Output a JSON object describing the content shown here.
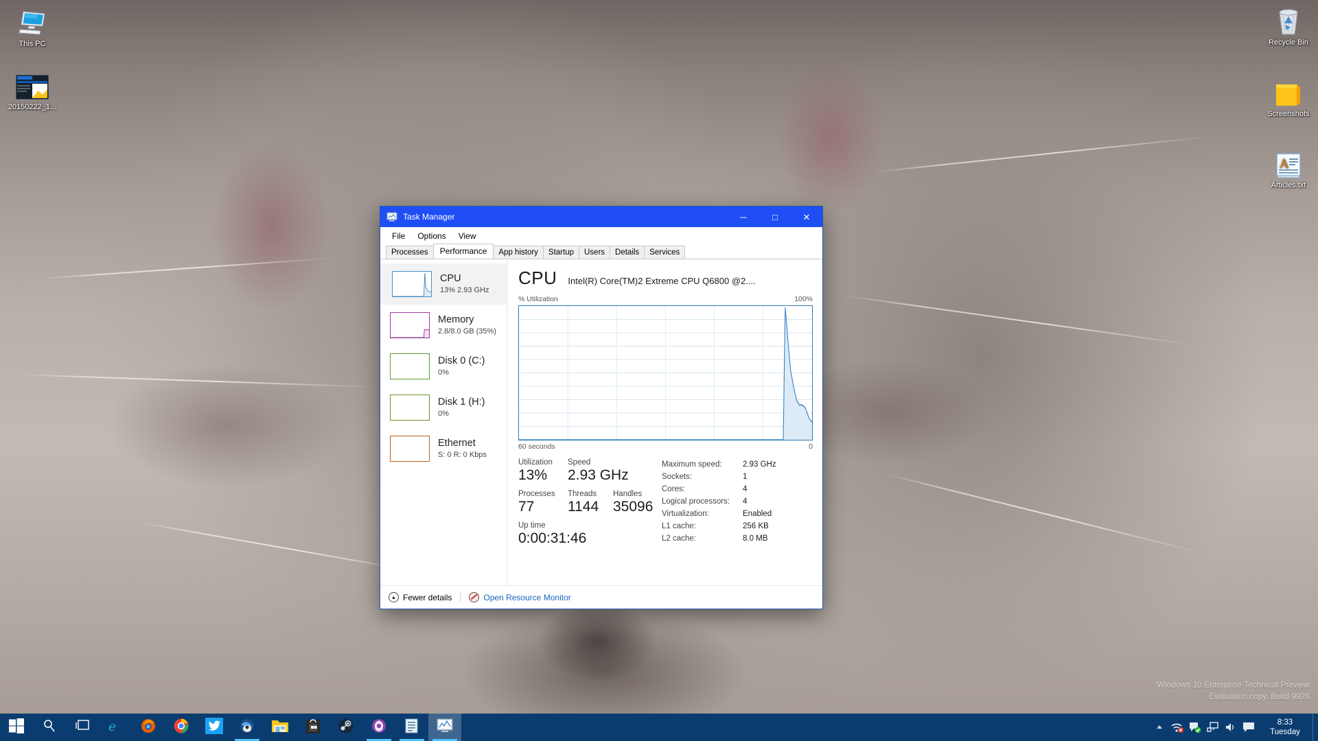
{
  "desktop": {
    "icons_left": [
      {
        "label": "This PC",
        "icon": "this-pc-icon"
      },
      {
        "label": "20150222_1...",
        "icon": "image-thumbnail-icon"
      }
    ],
    "icons_right": [
      {
        "label": "Recycle Bin",
        "icon": "recycle-bin-icon"
      },
      {
        "label": "Screenshots",
        "icon": "folder-icon"
      },
      {
        "label": "Articles.txt",
        "icon": "text-document-icon"
      }
    ],
    "watermark_line1": "Windows 10 Enterprise Technical Preview",
    "watermark_line2": "Evaluation copy. Build 9926"
  },
  "window": {
    "title": "Task Manager",
    "title_icon": "task-manager-icon",
    "minimize_glyph": "─",
    "maximize_glyph": "□",
    "close_glyph": "✕",
    "menu": [
      "File",
      "Options",
      "View"
    ],
    "tabs": [
      {
        "label": "Processes",
        "active": false
      },
      {
        "label": "Performance",
        "active": true
      },
      {
        "label": "App history",
        "active": false
      },
      {
        "label": "Startup",
        "active": false
      },
      {
        "label": "Users",
        "active": false
      },
      {
        "label": "Details",
        "active": false
      },
      {
        "label": "Services",
        "active": false
      }
    ],
    "footer": {
      "fewer_details": "Fewer details",
      "fewer_details_glyph": "▲",
      "open_resource_monitor": "Open Resource Monitor"
    }
  },
  "resources": [
    {
      "name": "CPU",
      "sub": "13% 2.93 GHz",
      "color": "#4b8dc4",
      "selected": true
    },
    {
      "name": "Memory",
      "sub": "2.8/8.0 GB (35%)",
      "color": "#9c3ba0",
      "selected": false
    },
    {
      "name": "Disk 0 (C:)",
      "sub": "0%",
      "color": "#5b9a2e",
      "selected": false
    },
    {
      "name": "Disk 1 (H:)",
      "sub": "0%",
      "color": "#6b8f2e",
      "selected": false
    },
    {
      "name": "Ethernet",
      "sub": "S: 0 R: 0 Kbps",
      "color": "#b5651d",
      "selected": false
    }
  ],
  "cpu": {
    "heading": "CPU",
    "model": "Intel(R) Core(TM)2 Extreme CPU Q6800 @2....",
    "graph_top_left": "% Utilization",
    "graph_top_right": "100%",
    "graph_bottom_left": "60 seconds",
    "graph_bottom_right": "0",
    "stats": {
      "utilization_label": "Utilization",
      "utilization_value": "13%",
      "speed_label": "Speed",
      "speed_value": "2.93 GHz",
      "processes_label": "Processes",
      "processes_value": "77",
      "threads_label": "Threads",
      "threads_value": "1144",
      "handles_label": "Handles",
      "handles_value": "35096",
      "uptime_label": "Up time",
      "uptime_value": "0:00:31:46"
    },
    "info": [
      {
        "key": "Maximum speed:",
        "value": "2.93 GHz"
      },
      {
        "key": "Sockets:",
        "value": "1"
      },
      {
        "key": "Cores:",
        "value": "4"
      },
      {
        "key": "Logical processors:",
        "value": "4"
      },
      {
        "key": "Virtualization:",
        "value": "Enabled"
      },
      {
        "key": "L1 cache:",
        "value": "256 KB"
      },
      {
        "key": "L2 cache:",
        "value": "8.0 MB"
      }
    ]
  },
  "chart_data": {
    "type": "area",
    "title": "CPU % Utilization",
    "xlabel": "60 seconds",
    "ylabel": "% Utilization",
    "ylim": [
      0,
      100
    ],
    "xlim": [
      60,
      0
    ],
    "grid": true,
    "grid_cols": 6,
    "grid_rows": 10,
    "line_color": "#3f87c7",
    "fill_color": "#dcebf7",
    "note": "Idle for most of the 60s window; a spike to 100% occurred ~4s ago then decayed to ~13%.",
    "x": [
      60,
      55,
      50,
      45,
      40,
      35,
      30,
      25,
      20,
      15,
      10,
      8,
      7,
      6,
      5,
      4.5,
      4,
      3.5,
      3,
      2.5,
      2,
      1.5,
      1,
      0.5,
      0
    ],
    "values": [
      0,
      0,
      0,
      0,
      0,
      0,
      0,
      0,
      0,
      0,
      0,
      0,
      0,
      0,
      0,
      0,
      100,
      72,
      52,
      40,
      30,
      22,
      15,
      14,
      13
    ]
  },
  "taskbar": {
    "items": [
      {
        "name": "start-button",
        "icon": "windows-logo-icon",
        "running": false,
        "active": false
      },
      {
        "name": "search-button",
        "icon": "search-icon",
        "running": false,
        "active": false
      },
      {
        "name": "task-view-button",
        "icon": "task-view-icon",
        "running": false,
        "active": false
      },
      {
        "name": "internet-explorer",
        "icon": "internet-explorer-icon",
        "running": false,
        "active": false
      },
      {
        "name": "firefox",
        "icon": "firefox-icon",
        "running": false,
        "active": false
      },
      {
        "name": "chrome",
        "icon": "chrome-icon",
        "running": false,
        "active": false
      },
      {
        "name": "twitter",
        "icon": "twitter-icon",
        "running": false,
        "active": false
      },
      {
        "name": "thunderbird",
        "icon": "thunderbird-icon",
        "running": true,
        "active": false
      },
      {
        "name": "file-explorer",
        "icon": "folder-icon",
        "running": false,
        "active": false
      },
      {
        "name": "store",
        "icon": "store-icon",
        "running": false,
        "active": false
      },
      {
        "name": "steam",
        "icon": "steam-icon",
        "running": false,
        "active": false
      },
      {
        "name": "media-player",
        "icon": "media-player-icon",
        "running": true,
        "active": false
      },
      {
        "name": "notepad",
        "icon": "document-icon",
        "running": true,
        "active": false
      },
      {
        "name": "task-manager",
        "icon": "task-manager-icon",
        "running": true,
        "active": true
      }
    ],
    "tray": [
      {
        "name": "show-hidden-icons",
        "glyph": "▲"
      },
      {
        "name": "network-error-icon",
        "glyph": ""
      },
      {
        "name": "security-ok-icon",
        "glyph": ""
      },
      {
        "name": "network-icon",
        "glyph": ""
      },
      {
        "name": "volume-icon",
        "glyph": ""
      },
      {
        "name": "action-center-icon",
        "glyph": ""
      }
    ],
    "clock_time": "8:33",
    "clock_date": "Tuesday"
  }
}
